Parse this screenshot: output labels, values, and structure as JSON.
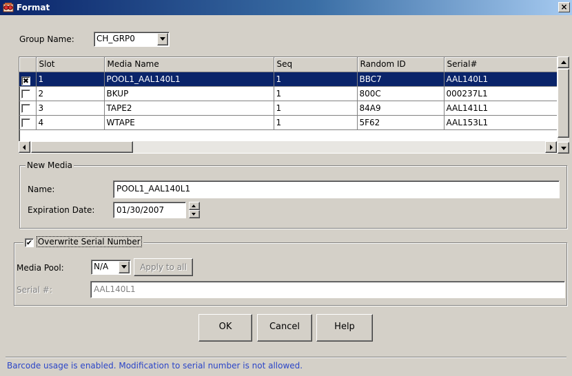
{
  "window": {
    "title": "Format",
    "close_glyph": "×"
  },
  "group": {
    "label": "Group Name:",
    "value": "CH_GRP0"
  },
  "table": {
    "columns": [
      "Slot",
      "Media Name",
      "Seq",
      "Random ID",
      "Serial#"
    ],
    "rows": [
      {
        "checked": true,
        "slot": "1",
        "media_name": "POOL1_AAL140L1",
        "seq": "1",
        "random_id": "BBC7",
        "serial": "AAL140L1",
        "selected": true
      },
      {
        "checked": false,
        "slot": "2",
        "media_name": "BKUP",
        "seq": "1",
        "random_id": "800C",
        "serial": "000237L1",
        "selected": false
      },
      {
        "checked": false,
        "slot": "3",
        "media_name": "TAPE2",
        "seq": "1",
        "random_id": "84A9",
        "serial": "AAL141L1",
        "selected": false
      },
      {
        "checked": false,
        "slot": "4",
        "media_name": "WTAPE",
        "seq": "1",
        "random_id": "5F62",
        "serial": "AAL153L1",
        "selected": false
      }
    ]
  },
  "new_media": {
    "legend": "New Media",
    "name_label": "Name:",
    "name_value": "POOL1_AAL140L1",
    "expiration_label": "Expiration Date:",
    "expiration_value": "01/30/2007"
  },
  "overwrite": {
    "legend": "Overwrite Serial Number",
    "checked": true,
    "media_pool_label": "Media Pool:",
    "media_pool_value": "N/A",
    "apply_all_label": "Apply to all",
    "serial_label": "Serial #:",
    "serial_value": "AAL140L1"
  },
  "buttons": {
    "ok": "OK",
    "cancel": "Cancel",
    "help": "Help"
  },
  "status": {
    "text": "Barcode usage is enabled. Modification to serial number is not allowed.",
    "color": "#2b45c8"
  },
  "colors": {
    "titlebar": "#0a246a",
    "selection": "#0a246a",
    "background": "#d4d0c8"
  },
  "icons": {
    "title": "format-window-icon",
    "check_mark": "✔",
    "x_mark": "✖"
  }
}
